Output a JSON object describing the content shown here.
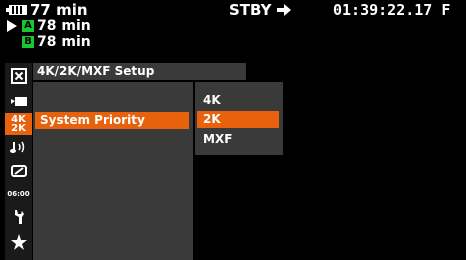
{
  "status": {
    "record_minutes": "77 min",
    "media_a_label": "A",
    "media_a_time": "78 min",
    "media_b_label": "B",
    "media_b_time": "78 min",
    "mode": "STBY",
    "timecode": "01:39:22.17 F"
  },
  "menu": {
    "title": "4K/2K/MXF Setup",
    "main_items": [
      {
        "label": "System Priority",
        "selected": true
      }
    ],
    "sub_items": [
      {
        "label": "4K",
        "selected": false
      },
      {
        "label": "2K",
        "selected": true
      },
      {
        "label": "MXF",
        "selected": false
      }
    ]
  },
  "sidebar": {
    "icons": [
      "close-icon",
      "camera-icon",
      "4k-2k-icon",
      "audio-icon",
      "display-icon",
      "timecode-icon",
      "wrench-icon",
      "star-icon"
    ],
    "timecode_icon_text": "06:00",
    "quality_top": "4K",
    "quality_bottom": "2K"
  },
  "colors": {
    "accent": "#e8610d",
    "media_badge": "#17c72f",
    "panel": "#3a3a3a"
  }
}
